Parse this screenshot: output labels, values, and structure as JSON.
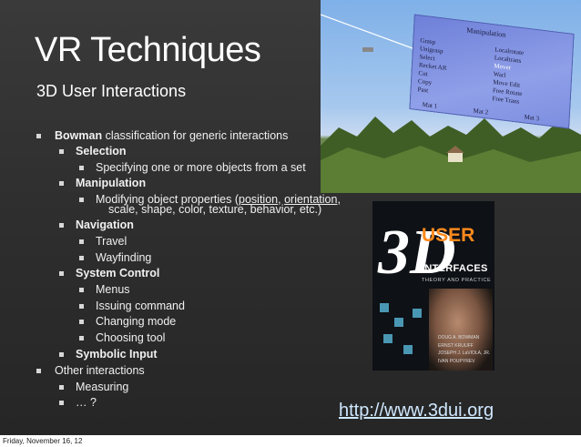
{
  "slide": {
    "title": "VR Techniques",
    "subtitle": "3D User Interactions",
    "bullets": [
      {
        "level": 1,
        "bold": "Bowman",
        "text": " classification for generic interactions"
      },
      {
        "level": 2,
        "bold": "Selection"
      },
      {
        "level": 3,
        "text": "Specifying one or more objects from a set"
      },
      {
        "level": 2,
        "bold": "Manipulation"
      },
      {
        "level": 3,
        "text_before": "Modifying object properties (",
        "u1": "position",
        "mid": ", ",
        "u2": "orientation",
        "after": ",",
        "text_line2": "scale, shape, color, texture, behavior, etc.)"
      },
      {
        "level": 2,
        "bold": "Navigation"
      },
      {
        "level": 3,
        "text": "Travel"
      },
      {
        "level": 3,
        "text": "Wayfinding"
      },
      {
        "level": 2,
        "bold": "System Control"
      },
      {
        "level": 3,
        "text": "Menus"
      },
      {
        "level": 3,
        "text": "Issuing command"
      },
      {
        "level": 3,
        "text": "Changing mode"
      },
      {
        "level": 3,
        "text": "Choosing tool"
      },
      {
        "level": 2,
        "bold": "Symbolic Input"
      },
      {
        "level": 1,
        "text": "Other interactions"
      },
      {
        "level": 2,
        "text": "Measuring"
      },
      {
        "level": 2,
        "text": "… ?"
      }
    ],
    "link": "http://www.3dui.org"
  },
  "vr_image": {
    "panel_title": "Manipulation",
    "left_col": [
      "Grasp",
      "Unigrasp",
      "Select",
      "Recket AR",
      "Cut",
      "Copy",
      "Past"
    ],
    "right_col": [
      "Localrotate",
      "Localtrans",
      "Mover",
      "Warl",
      "Move Edit",
      "Free Rotate",
      "Free Trans"
    ],
    "bottom": [
      "Mat 1",
      "Mat 2",
      "Mat 3"
    ]
  },
  "book": {
    "big": "3D",
    "word1": "USER",
    "word2": "INTERFACES",
    "tagline": "THEORY AND PRACTICE",
    "authors": [
      "DOUG A. BOWMAN",
      "ERNST KRUIJFF",
      "JOSEPH J. LaVIOLA, JR.",
      "IVAN POUPYREV"
    ]
  },
  "footer": {
    "date": "Friday, November 16, 12"
  }
}
